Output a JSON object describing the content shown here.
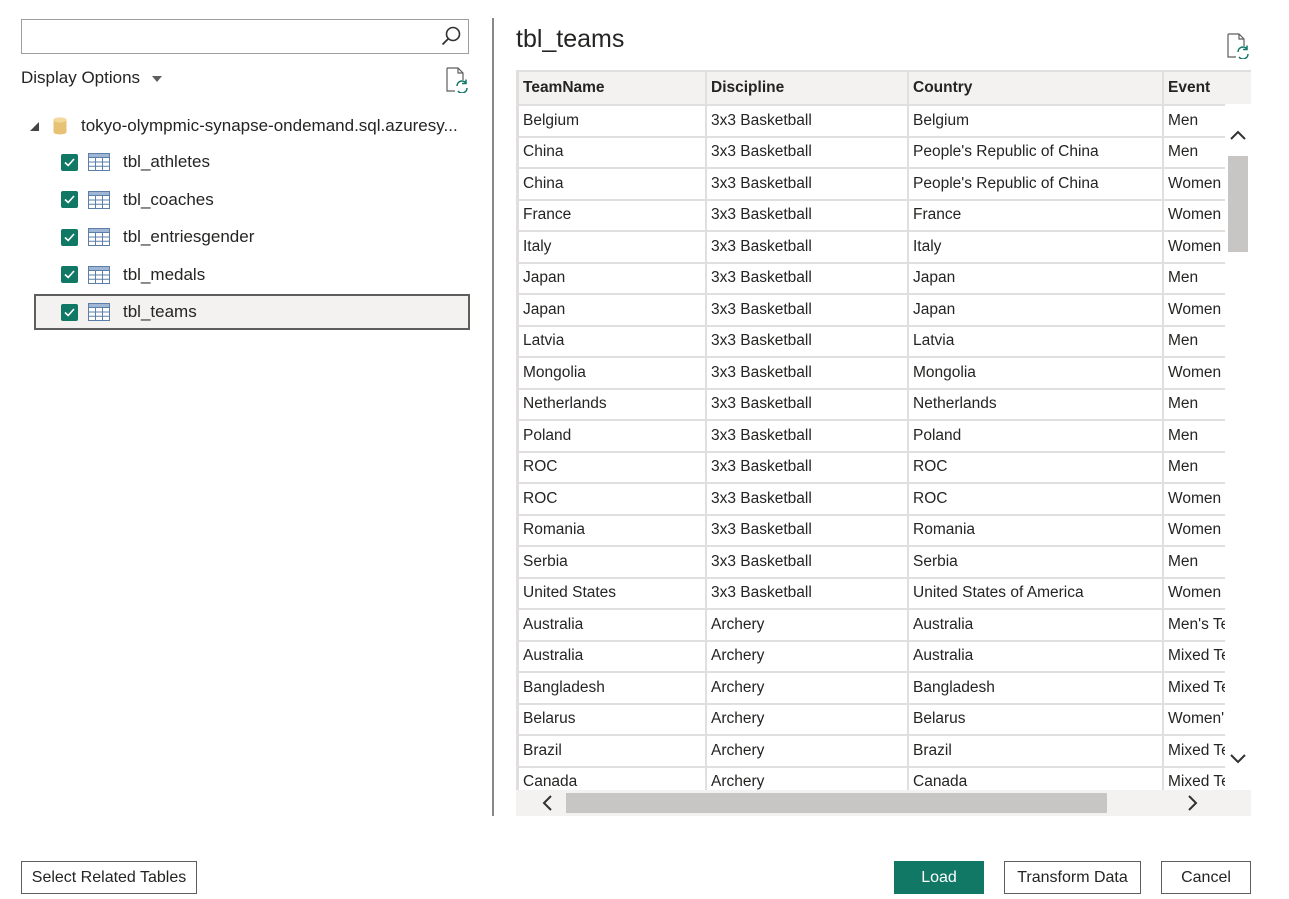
{
  "search": {
    "value": "",
    "placeholder": ""
  },
  "display_options": {
    "label": "Display Options"
  },
  "navigator": {
    "source": "tokyo-olympmic-synapse-ondemand.sql.azuresy...",
    "tables": [
      {
        "name": "tbl_athletes",
        "checked": true,
        "selected": false
      },
      {
        "name": "tbl_coaches",
        "checked": true,
        "selected": false
      },
      {
        "name": "tbl_entriesgender",
        "checked": true,
        "selected": false
      },
      {
        "name": "tbl_medals",
        "checked": true,
        "selected": false
      },
      {
        "name": "tbl_teams",
        "checked": true,
        "selected": true
      }
    ]
  },
  "preview": {
    "title": "tbl_teams",
    "columns": [
      "TeamName",
      "Discipline",
      "Country",
      "Event"
    ],
    "rows": [
      [
        "Belgium",
        "3x3 Basketball",
        "Belgium",
        "Men"
      ],
      [
        "China",
        "3x3 Basketball",
        "People's Republic of China",
        "Men"
      ],
      [
        "China",
        "3x3 Basketball",
        "People's Republic of China",
        "Women"
      ],
      [
        "France",
        "3x3 Basketball",
        "France",
        "Women"
      ],
      [
        "Italy",
        "3x3 Basketball",
        "Italy",
        "Women"
      ],
      [
        "Japan",
        "3x3 Basketball",
        "Japan",
        "Men"
      ],
      [
        "Japan",
        "3x3 Basketball",
        "Japan",
        "Women"
      ],
      [
        "Latvia",
        "3x3 Basketball",
        "Latvia",
        "Men"
      ],
      [
        "Mongolia",
        "3x3 Basketball",
        "Mongolia",
        "Women"
      ],
      [
        "Netherlands",
        "3x3 Basketball",
        "Netherlands",
        "Men"
      ],
      [
        "Poland",
        "3x3 Basketball",
        "Poland",
        "Men"
      ],
      [
        "ROC",
        "3x3 Basketball",
        "ROC",
        "Men"
      ],
      [
        "ROC",
        "3x3 Basketball",
        "ROC",
        "Women"
      ],
      [
        "Romania",
        "3x3 Basketball",
        "Romania",
        "Women"
      ],
      [
        "Serbia",
        "3x3 Basketball",
        "Serbia",
        "Men"
      ],
      [
        "United States",
        "3x3 Basketball",
        "United States of America",
        "Women"
      ],
      [
        "Australia",
        "Archery",
        "Australia",
        "Men's Te"
      ],
      [
        "Australia",
        "Archery",
        "Australia",
        "Mixed Te"
      ],
      [
        "Bangladesh",
        "Archery",
        "Bangladesh",
        "Mixed Te"
      ],
      [
        "Belarus",
        "Archery",
        "Belarus",
        "Women'"
      ],
      [
        "Brazil",
        "Archery",
        "Brazil",
        "Mixed Te"
      ],
      [
        "Canada",
        "Archery",
        "Canada",
        "Mixed Te"
      ]
    ]
  },
  "buttons": {
    "select_related": "Select Related Tables",
    "load": "Load",
    "transform": "Transform Data",
    "cancel": "Cancel"
  },
  "colors": {
    "accent": "#117865",
    "border": "#605e5c",
    "grid_line": "#e1dfdd",
    "header_bg": "#f3f2f1"
  },
  "icons": [
    "search-icon",
    "chevron-down-icon",
    "refresh-icon",
    "database-icon",
    "table-icon",
    "checkmark-icon",
    "scroll-up-icon",
    "scroll-down-icon",
    "scroll-left-icon",
    "scroll-right-icon"
  ]
}
